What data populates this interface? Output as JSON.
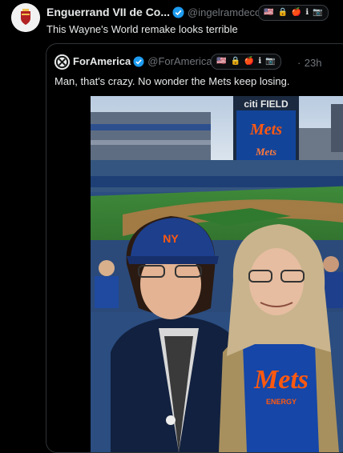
{
  "tweet": {
    "author_name": "Enguerrand VII de Co...",
    "author_handle": "@ingelramdeco...",
    "text": "This Wayne's World remake looks terrible",
    "badges": [
      "🇺🇸",
      "🔒",
      "🍎",
      "ℹ",
      "📷"
    ]
  },
  "quoted": {
    "author_name": "ForAmerica",
    "author_handle": "@ForAmerica",
    "separator": "·",
    "time": "23h",
    "text": "Man, that's crazy. No wonder the Mets keep losing.",
    "badges": [
      "🇺🇸",
      "🔒",
      "🍎",
      "ℹ",
      "📷"
    ]
  },
  "photo": {
    "scoreboard_top": "citi FIELD",
    "scoreboard_logo": "Mets",
    "shirt_text": "Mets",
    "shirt_sub": "ENERGY",
    "cap_logo": "NY"
  },
  "colors": {
    "accent": "#1d9bf0",
    "mets_orange": "#ff5910",
    "mets_blue": "#002d72"
  }
}
